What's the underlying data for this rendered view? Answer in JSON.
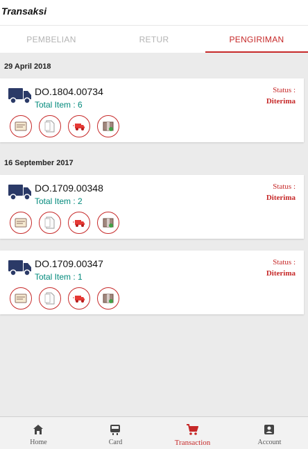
{
  "header": {
    "title": "Transaksi"
  },
  "tabs": [
    {
      "label": "PEMBELIAN",
      "active": false
    },
    {
      "label": "RETUR",
      "active": false
    },
    {
      "label": "PENGIRIMAN",
      "active": true
    }
  ],
  "groups": [
    {
      "date": "29 April 2018"
    },
    {
      "date": "16 September 2017"
    }
  ],
  "shipments": [
    {
      "do_number": "DO.1804.00734",
      "total": "Total Item : 6",
      "status_label": "Status :",
      "status_value": "Diterima"
    },
    {
      "do_number": "DO.1709.00348",
      "total": "Total Item : 2",
      "status_label": "Status :",
      "status_value": "Diterima"
    },
    {
      "do_number": "DO.1709.00347",
      "total": "Total Item : 1",
      "status_label": "Status :",
      "status_value": "Diterima"
    }
  ],
  "action_icons": [
    "invoice-icon",
    "document-icon",
    "delivery-truck-icon",
    "package-icon"
  ],
  "nav": [
    {
      "label": "Home",
      "icon": "home-icon",
      "active": false
    },
    {
      "label": "Card",
      "icon": "card-icon",
      "active": false
    },
    {
      "label": "Transaction",
      "icon": "cart-icon",
      "active": true
    },
    {
      "label": "Account",
      "icon": "account-icon",
      "active": false
    }
  ],
  "colors": {
    "accent": "#c62828",
    "truck": "#2b3a67",
    "teal": "#00897b",
    "background": "#ebebeb"
  }
}
